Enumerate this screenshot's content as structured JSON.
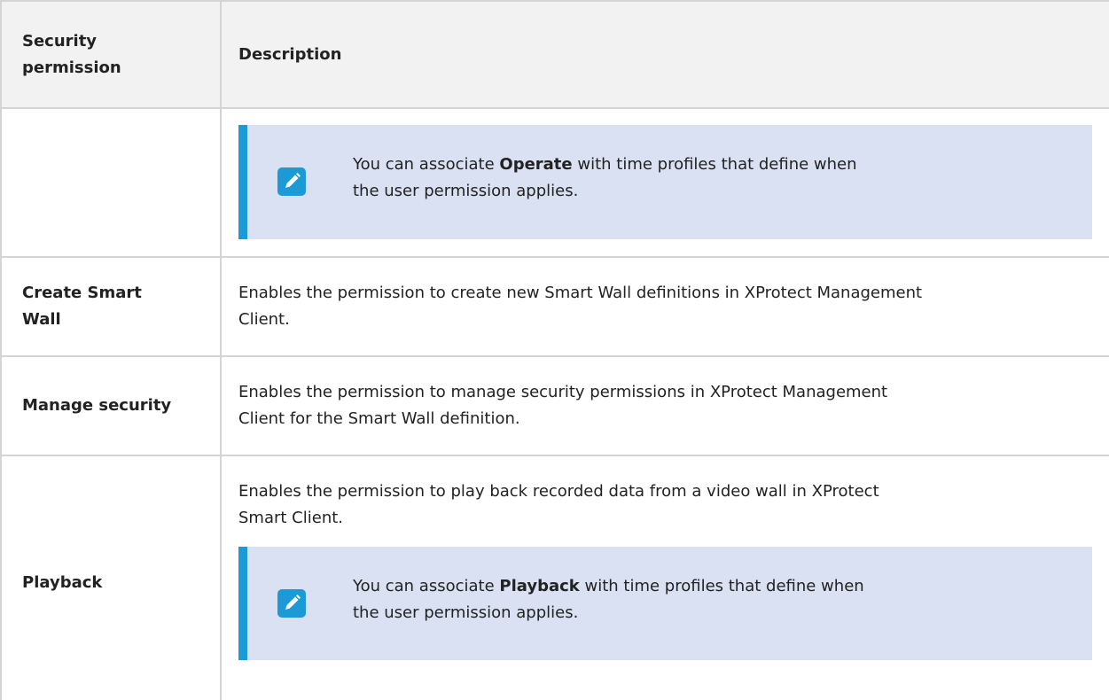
{
  "header": {
    "col1_line1": "Security",
    "col1_line2": "permission",
    "col2": "Description"
  },
  "rows": [
    {
      "note": {
        "pre": "You can associate ",
        "bold": "Operate",
        "post": " with time profiles that define when",
        "line2": "the user permission applies.",
        "icon": "pencil-icon"
      }
    },
    {
      "name_line1": "Create Smart",
      "name_line2": "Wall",
      "desc_line1": "Enables the permission to create new Smart Wall definitions in XProtect Management",
      "desc_line2": "Client."
    },
    {
      "name": "Manage security",
      "desc_line1": "Enables the permission to manage security permissions in XProtect Management",
      "desc_line2": "Client for the Smart Wall definition."
    },
    {
      "name": "Playback",
      "desc_line1": "Enables the permission to play back recorded data from a video wall in XProtect",
      "desc_line2": "Smart Client.",
      "note": {
        "pre": "You can associate ",
        "bold": "Playback",
        "post": " with time profiles that define when",
        "line2": "the user permission applies.",
        "icon": "pencil-icon"
      }
    }
  ],
  "colors": {
    "header_bg": "#f2f2f2",
    "note_bg": "#d9e1f2",
    "accent": "#1b9ad6",
    "grid": "#d4d4d4"
  }
}
